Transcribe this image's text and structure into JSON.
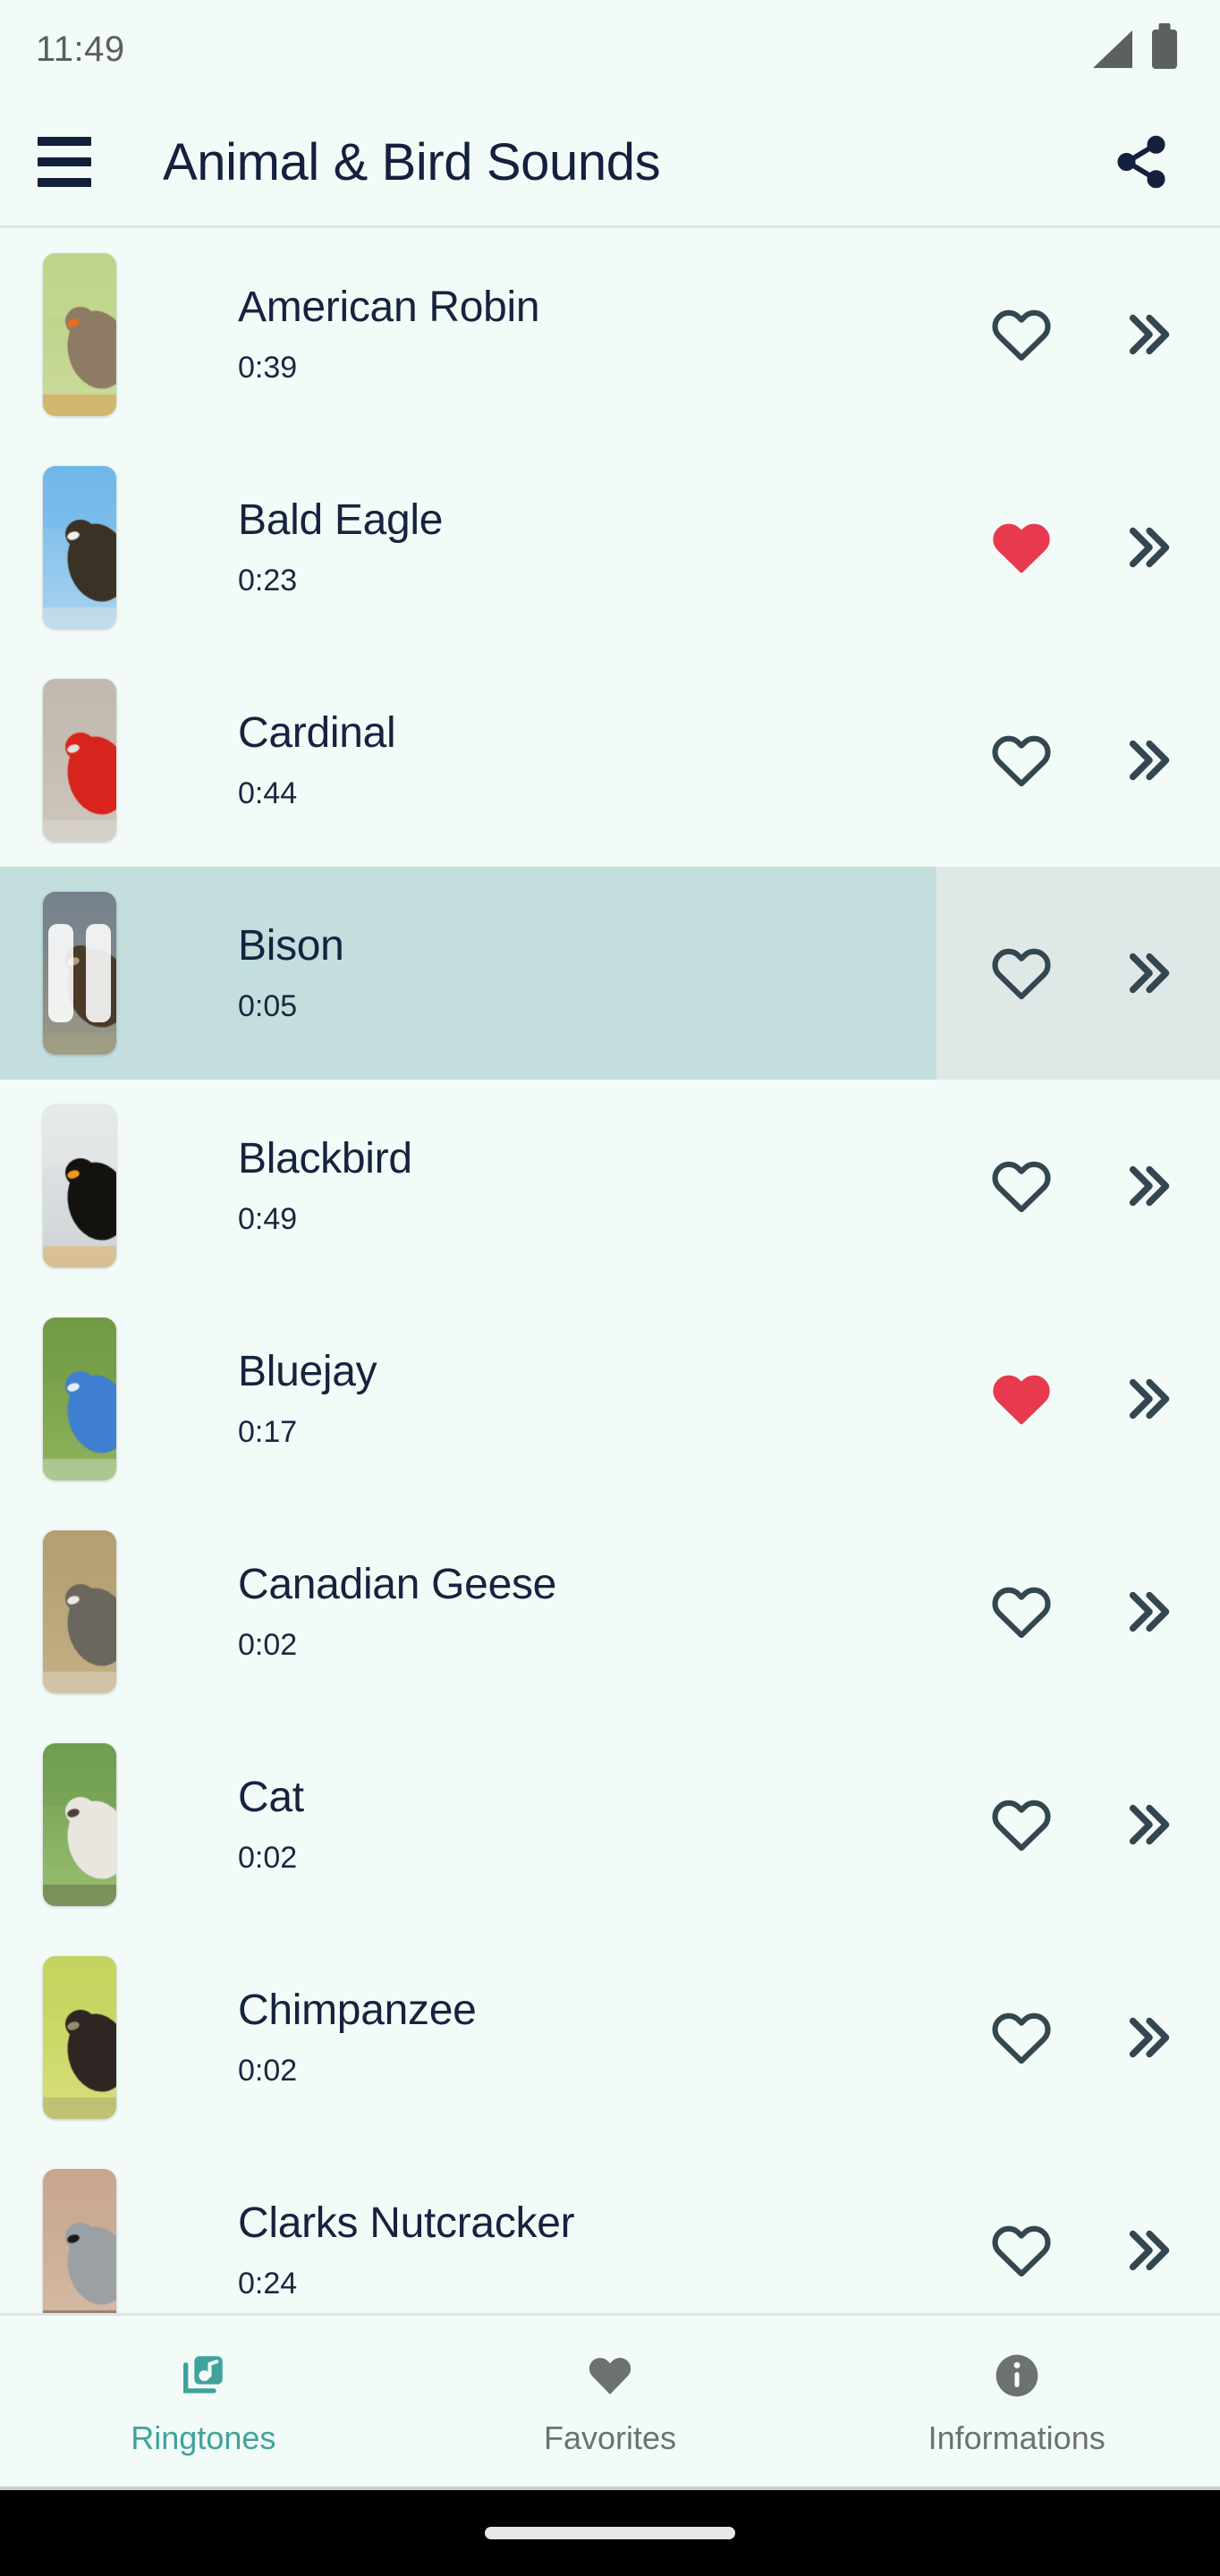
{
  "status_bar": {
    "clock": "11:49",
    "signal_icon": "signal-bars-icon",
    "battery_icon": "battery-full-icon"
  },
  "app_bar": {
    "menu_icon": "hamburger-menu-icon",
    "title": "Animal & Bird Sounds",
    "share_icon": "share-icon"
  },
  "colors": {
    "page_background": "#f2fbf7",
    "title_text": "#14203d",
    "playing_row_background": "#c3dedd",
    "playing_row_actions_background": "#e0e8e7",
    "favorite_active": "#e8394f",
    "favorite_inactive": "#34464f",
    "accent_teal": "#3fa39c",
    "nav_inactive": "#6b7270"
  },
  "list": {
    "favorite_icon": "heart-icon",
    "play_next_icon": "double-chevron-right-icon",
    "pause_icon": "pause-icon",
    "items": [
      {
        "name": "American Robin",
        "duration": "0:39",
        "favorite": false,
        "playing": false,
        "thumb": {
          "bg": [
            "#b9cf85",
            "#cbdc9a"
          ],
          "subject": "#8d7b63",
          "accent": "#e2701f",
          "sky": "#c3d98f"
        }
      },
      {
        "name": "Bald Eagle",
        "duration": "0:23",
        "favorite": true,
        "playing": false,
        "thumb": {
          "bg": [
            "#6fb6e8",
            "#a8d4f0"
          ],
          "subject": "#3b3226",
          "accent": "#f4efe6",
          "sky": "#72b8e9"
        }
      },
      {
        "name": "Cardinal",
        "duration": "0:44",
        "favorite": false,
        "playing": false,
        "thumb": {
          "bg": [
            "#bdb5ab",
            "#cfc8bf"
          ],
          "subject": "#d8241c",
          "accent": "#e6e2dc",
          "sky": "#c5bdb3"
        }
      },
      {
        "name": "Bison",
        "duration": "0:05",
        "favorite": false,
        "playing": true,
        "thumb": {
          "bg": [
            "#6f7b87",
            "#9a9a86"
          ],
          "subject": "#4b3a28",
          "accent": "#b0a585",
          "sky": "#7d8893"
        }
      },
      {
        "name": "Blackbird",
        "duration": "0:49",
        "favorite": false,
        "playing": false,
        "thumb": {
          "bg": [
            "#e8eaea",
            "#cdd3d6"
          ],
          "subject": "#14120f",
          "accent": "#eb9a1c",
          "sky": "#e6e9ea"
        }
      },
      {
        "name": "Bluejay",
        "duration": "0:17",
        "favorite": true,
        "playing": false,
        "thumb": {
          "bg": [
            "#6d9641",
            "#90b45c"
          ],
          "subject": "#3f7fd0",
          "accent": "#e7eef6",
          "sky": "#74a048"
        }
      },
      {
        "name": "Canadian Geese",
        "duration": "0:02",
        "favorite": false,
        "playing": false,
        "thumb": {
          "bg": [
            "#b39c6f",
            "#c5b087"
          ],
          "subject": "#6b675e",
          "accent": "#eceae3",
          "sky": "#b7a274"
        }
      },
      {
        "name": "Cat",
        "duration": "0:02",
        "favorite": false,
        "playing": false,
        "thumb": {
          "bg": [
            "#6e9b4d",
            "#9ac072"
          ],
          "subject": "#e9e6e0",
          "accent": "#4a4037",
          "sky": "#74a053"
        }
      },
      {
        "name": "Chimpanzee",
        "duration": "0:02",
        "favorite": false,
        "playing": false,
        "thumb": {
          "bg": [
            "#c3d159",
            "#d7e07a"
          ],
          "subject": "#2e2622",
          "accent": "#9a8a6f",
          "sky": "#c8d563"
        }
      },
      {
        "name": "Clarks Nutcracker",
        "duration": "0:24",
        "favorite": false,
        "playing": false,
        "thumb": {
          "bg": [
            "#c6a58e",
            "#d6bba6"
          ],
          "subject": "#9aa0a4",
          "accent": "#1b1b1b",
          "sky": "#c9a992"
        }
      }
    ]
  },
  "bottom_nav": {
    "items": [
      {
        "label": "Ringtones",
        "icon": "library-music-icon",
        "active": true
      },
      {
        "label": "Favorites",
        "icon": "heart-filled-icon",
        "active": false
      },
      {
        "label": "Informations",
        "icon": "info-circle-icon",
        "active": false
      }
    ]
  },
  "gesture_bar": {
    "handle": "home-gesture-handle"
  }
}
